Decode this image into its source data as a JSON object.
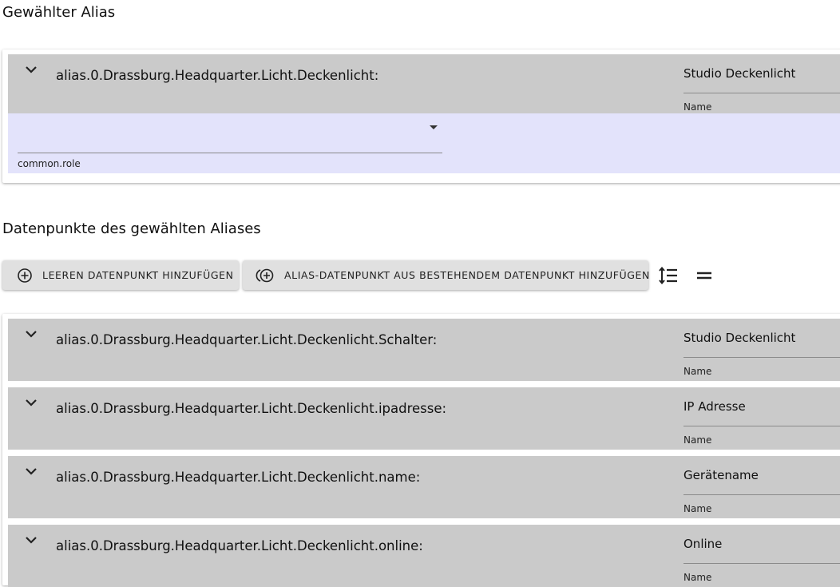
{
  "selected_alias": {
    "title": "Gewählter Alias",
    "path": "alias.0.Drassburg.Headquarter.Licht.Deckenlicht:",
    "name_value": "Studio Deckenlicht",
    "name_label": "Name",
    "role_value": "",
    "role_label": "common.role",
    "role_bg_color": "#e3e3fb"
  },
  "datapoints": {
    "title": "Datenpunkte des gewählten Aliases",
    "add_empty_label": "LEEREN DATENPUNKT HINZUFÜGEN",
    "add_from_existing_label": "ALIAS-DATENPUNKT AUS BESTEHENDEM DATENPUNKT HINZUFÜGEN",
    "sort_icon": "sort-lines-icon",
    "collapse_icon": "equals-icon",
    "items": [
      {
        "path": "alias.0.Drassburg.Headquarter.Licht.Deckenlicht.Schalter:",
        "name_value": "Studio Deckenlicht",
        "name_label": "Name"
      },
      {
        "path": "alias.0.Drassburg.Headquarter.Licht.Deckenlicht.ipadresse:",
        "name_value": "IP Adresse",
        "name_label": "Name"
      },
      {
        "path": "alias.0.Drassburg.Headquarter.Licht.Deckenlicht.name:",
        "name_value": "Gerätename",
        "name_label": "Name"
      },
      {
        "path": "alias.0.Drassburg.Headquarter.Licht.Deckenlicht.online:",
        "name_value": "Online",
        "name_label": "Name"
      }
    ]
  }
}
